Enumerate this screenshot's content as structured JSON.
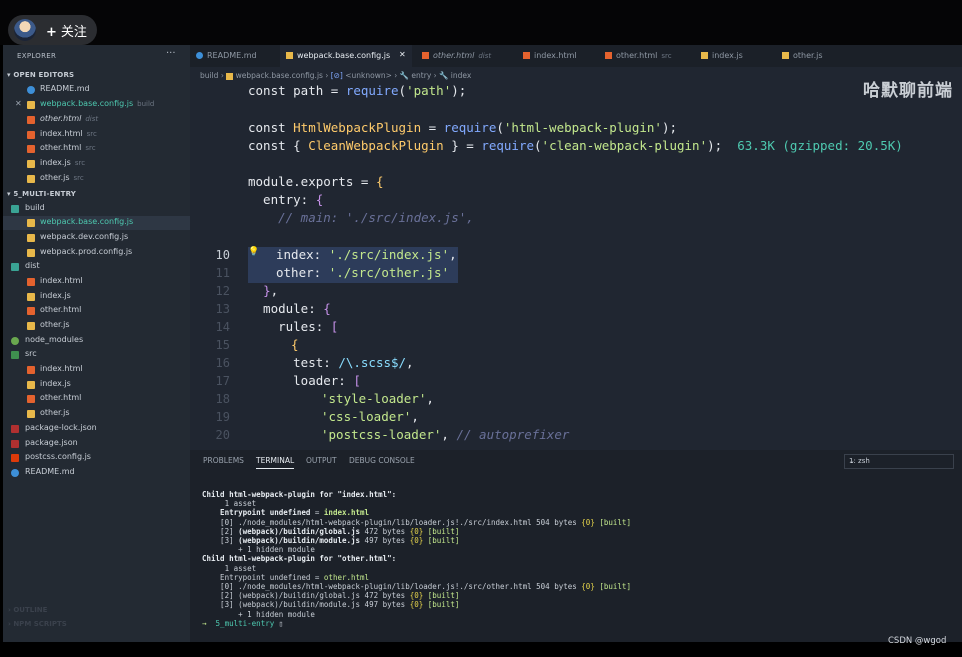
{
  "overlay": {
    "follow_label": "关注",
    "plus": "+",
    "watermark": "哈默聊前端",
    "csdn": "CSDN @wgod"
  },
  "sidebar": {
    "title": "EXPLORER",
    "more": "···",
    "open_editors_label": "OPEN EDITORS",
    "project_label": "5_MULTI-ENTRY",
    "outline_label": "OUTLINE",
    "npm_label": "NPM SCRIPTS",
    "open_editors": [
      {
        "name": "README.md",
        "hint": ""
      },
      {
        "name": "webpack.base.config.js",
        "hint": "build"
      },
      {
        "name": "other.html",
        "hint": "dist"
      },
      {
        "name": "index.html",
        "hint": "src"
      },
      {
        "name": "other.html",
        "hint": "src"
      },
      {
        "name": "index.js",
        "hint": "src"
      },
      {
        "name": "other.js",
        "hint": "src"
      }
    ],
    "tree": [
      {
        "name": "build"
      },
      {
        "name": "webpack.base.config.js"
      },
      {
        "name": "webpack.dev.config.js"
      },
      {
        "name": "webpack.prod.config.js"
      },
      {
        "name": "dist"
      },
      {
        "name": "index.html"
      },
      {
        "name": "index.js"
      },
      {
        "name": "other.html"
      },
      {
        "name": "other.js"
      },
      {
        "name": "node_modules"
      },
      {
        "name": "src"
      },
      {
        "name": "index.html"
      },
      {
        "name": "index.js"
      },
      {
        "name": "other.html"
      },
      {
        "name": "other.js"
      },
      {
        "name": "package-lock.json"
      },
      {
        "name": "package.json"
      },
      {
        "name": "postcss.config.js"
      },
      {
        "name": "README.md"
      }
    ]
  },
  "tabs": [
    {
      "name": "README.md",
      "hint": ""
    },
    {
      "name": "webpack.base.config.js",
      "hint": ""
    },
    {
      "name": "other.html",
      "hint": "dist"
    },
    {
      "name": "index.html",
      "hint": ""
    },
    {
      "name": "other.html",
      "hint": "src"
    },
    {
      "name": "index.js",
      "hint": ""
    },
    {
      "name": "other.js",
      "hint": ""
    }
  ],
  "tab_close": "✕",
  "breadcrumb": {
    "folder": "build",
    "file": "webpack.base.config.js",
    "unknown": "<unknown>",
    "entry": "entry",
    "index": "index"
  },
  "line_numbers": [
    "10",
    "11",
    "12",
    "13",
    "14",
    "15",
    "16",
    "17",
    "18",
    "19",
    "20"
  ],
  "code": {
    "l1a": "const path = ",
    "l1b": "require",
    "l1c": "(",
    "l1d": "'path'",
    "l1e": ");",
    "l3a": "const ",
    "l3b": "HtmlWebpackPlugin",
    "l3c": " = ",
    "l3d": "require",
    "l3e": "(",
    "l3f": "'html-webpack-plugin'",
    "l3g": ");",
    "l4a": "const { ",
    "l4b": "CleanWebpackPlugin",
    "l4c": " } = ",
    "l4d": "require",
    "l4e": "(",
    "l4f": "'clean-webpack-plugin'",
    "l4g": ");",
    "l4size": "63.3K (gzipped: 20.5K)",
    "l6a": "module.exports = ",
    "l6b": "{",
    "l7a": "  entry: ",
    "l7b": "{",
    "l8": "    // main: './src/index.js',",
    "l10a": "index: ",
    "l10b": "'./src/index.js'",
    "l10c": ",",
    "l11a": "other: ",
    "l11b": "'./src/other.js'",
    "l12a": "  ",
    "l12b": "}",
    "l12c": ",",
    "l13a": "  module: ",
    "l13b": "{",
    "l14a": "    rules: ",
    "l14b": "[",
    "l15": "{",
    "l16a": "      test: ",
    "l16b": "/\\.scss$/",
    "l16c": ",",
    "l17a": "      loader: ",
    "l17b": "[",
    "l18a": "'style-loader'",
    "l18b": ",",
    "l19a": "'css-loader'",
    "l19b": ",",
    "l20a": "'postcss-loader'",
    "l20b": ", ",
    "l20c": "// autoprefixer"
  },
  "panel": {
    "tabs": [
      "PROBLEMS",
      "TERMINAL",
      "OUTPUT",
      "DEBUG CONSOLE"
    ],
    "terminal_select": "1: zsh",
    "chevron": "⌄"
  },
  "terminal": {
    "c1a": "Child ",
    "c1b": "html-webpack-plugin",
    "c1c": " for ",
    "c1d": "\"index.html\"",
    "c1e": ":",
    "c1_asset": "     1 asset",
    "c1_entry_a": "    Entrypoint ",
    "c1_entry_b": "undefined",
    "c1_entry_c": " = ",
    "c1_entry_d": "index.html",
    "c1_l0a": "    [0] ./node_modules/html-webpack-plugin/lib/loader.js!./src/index.html 504 bytes ",
    "c1_l0b": "{0}",
    "c1_l0c": " [built]",
    "c1_l2a": "    [2] ",
    "c1_l2b": "(webpack)/buildin/global.js",
    "c1_l2c": " 472 bytes ",
    "c1_l2d": "{0}",
    "c1_l2e": " [built]",
    "c1_l3a": "    [3] ",
    "c1_l3b": "(webpack)/buildin/module.js",
    "c1_l3c": " 497 bytes ",
    "c1_l3d": "{0}",
    "c1_l3e": " [built]",
    "c1_hidden": "        + 1 hidden module",
    "c2a": "Child ",
    "c2b": "html-webpack-plugin",
    "c2c": " for ",
    "c2d": "\"other.html\"",
    "c2e": ":",
    "c2_asset": "     1 asset",
    "c2_entry_a": "    Entrypoint ",
    "c2_entry_b": "undefined",
    "c2_entry_c": " = ",
    "c2_entry_d": "other.html",
    "c2_l0a": "    [0] ./node_modules/html-webpack-plugin/lib/loader.js!./src/other.html 504 bytes ",
    "c2_l0b": "{0}",
    "c2_l0c": " [built]",
    "c2_l2a": "    [2] (webpack)/buildin/global.js 472 bytes ",
    "c2_l2b": "{0}",
    "c2_l2c": " [built]",
    "c2_l3a": "    [3] (webpack)/buildin/module.js 497 bytes ",
    "c2_l3b": "{0}",
    "c2_l3c": " [built]",
    "c2_hidden": "        + 1 hidden module",
    "prompt_arrow": "→",
    "prompt_dir": "5_multi-entry",
    "prompt_cursor": "▯"
  }
}
